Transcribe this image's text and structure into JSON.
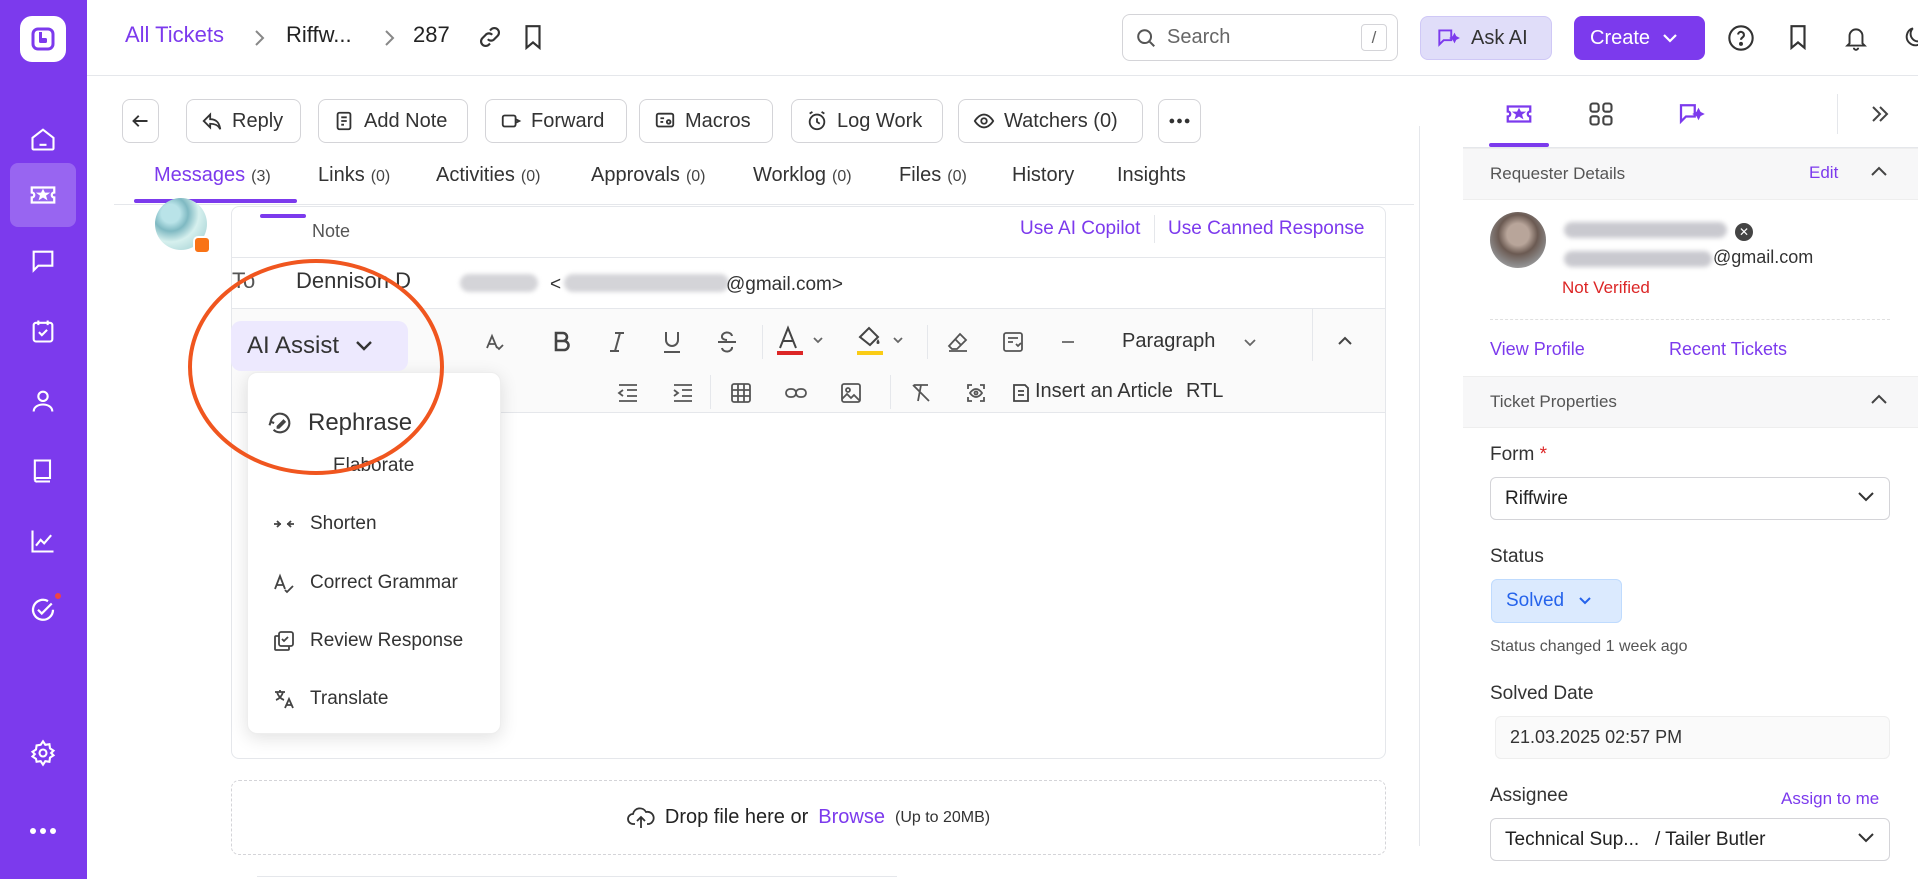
{
  "sidebar": {
    "items": [
      {
        "name": "home"
      },
      {
        "name": "tickets",
        "active": true
      },
      {
        "name": "chat"
      },
      {
        "name": "tasks"
      },
      {
        "name": "contacts"
      },
      {
        "name": "knowledge-base"
      },
      {
        "name": "reports"
      },
      {
        "name": "approvals",
        "badge": true
      },
      {
        "name": "settings"
      },
      {
        "name": "more"
      }
    ]
  },
  "topbar": {
    "breadcrumb_all": "All Tickets",
    "breadcrumb_org": "Riffw...",
    "breadcrumb_id": "287",
    "search_placeholder": "Search",
    "search_shortcut": "/",
    "ask_ai": "Ask AI",
    "create": "Create"
  },
  "actions": {
    "reply": "Reply",
    "add_note": "Add Note",
    "forward": "Forward",
    "macros": "Macros",
    "log_work": "Log Work",
    "watchers": "Watchers (0)",
    "more": "•••"
  },
  "tabs": [
    {
      "label": "Messages",
      "count": "(3)",
      "active": true
    },
    {
      "label": "Links",
      "count": "(0)"
    },
    {
      "label": "Activities",
      "count": "(0)"
    },
    {
      "label": "Approvals",
      "count": "(0)"
    },
    {
      "label": "Worklog",
      "count": "(0)"
    },
    {
      "label": "Files",
      "count": "(0)"
    },
    {
      "label": "History",
      "count": ""
    },
    {
      "label": "Insights",
      "count": ""
    }
  ],
  "composer": {
    "mode_tab": "Note",
    "use_ai_copilot": "Use AI Copilot",
    "use_canned": "Use Canned Response",
    "to_label": "To",
    "to_name": "Dennison D",
    "to_email_prefix": "<",
    "to_email_domain": "@gmail.com>",
    "paragraph": "Paragraph",
    "insert_article": "Insert an Article",
    "rtl": "RTL"
  },
  "ai_assist": {
    "button": "AI Assist",
    "items": [
      {
        "label": "Rephrase",
        "icon": "rephrase-icon"
      },
      {
        "label": "Elaborate",
        "icon": "elaborate-icon"
      },
      {
        "label": "Shorten",
        "icon": "shorten-icon"
      },
      {
        "label": "Correct Grammar",
        "icon": "grammar-icon"
      },
      {
        "label": "Review Response",
        "icon": "review-icon"
      },
      {
        "label": "Translate",
        "icon": "translate-icon"
      }
    ]
  },
  "dropzone": {
    "text": "Drop file here or",
    "browse": "Browse",
    "limit": "(Up to 20MB)"
  },
  "right_panel": {
    "requester_title": "Requester Details",
    "edit": "Edit",
    "requester_email": "@gmail.com",
    "not_verified": "Not Verified",
    "view_profile": "View Profile",
    "recent_tickets": "Recent Tickets",
    "props_title": "Ticket Properties",
    "form_label": "Form",
    "form_required": "*",
    "form_value": "Riffwire",
    "status_label": "Status",
    "status_value": "Solved",
    "status_meta": "Status changed 1 week ago",
    "solved_date_label": "Solved Date",
    "solved_date": "21.03.2025 02:57 PM",
    "assignee_label": "Assignee",
    "assign_to_me": "Assign to me",
    "assignee_value": "Technical Sup...   / Tailer Butler"
  },
  "colors": {
    "brand": "#7c3aed",
    "callout": "#f0561f",
    "status_blue": "#2563eb",
    "not_verified": "#dc2626"
  }
}
